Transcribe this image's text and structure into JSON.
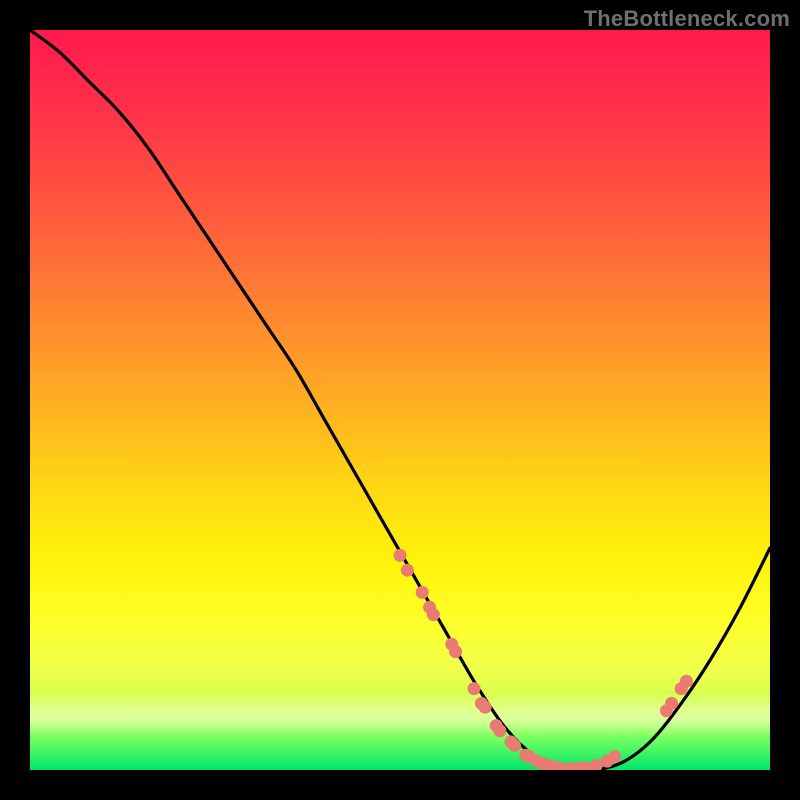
{
  "attribution": "TheBottleneck.com",
  "chart_data": {
    "type": "line",
    "title": "",
    "xlabel": "",
    "ylabel": "",
    "xlim": [
      0,
      100
    ],
    "ylim": [
      0,
      100
    ],
    "background_gradient": {
      "orientation": "vertical",
      "stops": [
        {
          "pos": 0.0,
          "color": "#ff1a4d"
        },
        {
          "pos": 0.25,
          "color": "#ff5a3d"
        },
        {
          "pos": 0.5,
          "color": "#ffb41f"
        },
        {
          "pos": 0.72,
          "color": "#fff40a"
        },
        {
          "pos": 0.92,
          "color": "#c8ff50"
        },
        {
          "pos": 1.0,
          "color": "#00e46a"
        }
      ]
    },
    "series": [
      {
        "name": "bottleneck-curve",
        "color": "#000000",
        "x": [
          0,
          4,
          8,
          12,
          16,
          20,
          24,
          28,
          32,
          36,
          40,
          44,
          48,
          52,
          56,
          60,
          64,
          68,
          72,
          76,
          80,
          84,
          88,
          92,
          96,
          100
        ],
        "values": [
          100,
          97,
          93,
          89,
          84,
          78,
          72,
          66,
          60,
          54,
          47,
          40,
          33,
          26,
          19,
          12,
          6,
          2,
          0,
          0,
          1,
          4,
          9,
          15,
          22,
          30
        ]
      }
    ],
    "scatter": [
      {
        "name": "highlight-points",
        "color": "#e97b73",
        "points": [
          {
            "x": 50,
            "y": 29
          },
          {
            "x": 51,
            "y": 27
          },
          {
            "x": 53,
            "y": 24
          },
          {
            "x": 54,
            "y": 22
          },
          {
            "x": 54.5,
            "y": 21
          },
          {
            "x": 57,
            "y": 17
          },
          {
            "x": 57.5,
            "y": 16
          },
          {
            "x": 60,
            "y": 11
          },
          {
            "x": 61,
            "y": 9
          },
          {
            "x": 61.5,
            "y": 8.5
          },
          {
            "x": 63,
            "y": 6
          },
          {
            "x": 63.5,
            "y": 5.3
          },
          {
            "x": 65,
            "y": 3.8
          },
          {
            "x": 65.5,
            "y": 3.3
          },
          {
            "x": 67,
            "y": 2
          },
          {
            "x": 67.5,
            "y": 1.8
          },
          {
            "x": 68.5,
            "y": 1.2
          },
          {
            "x": 69.5,
            "y": 0.8
          },
          {
            "x": 70.5,
            "y": 0.5
          },
          {
            "x": 71.5,
            "y": 0.3
          },
          {
            "x": 73,
            "y": 0.2
          },
          {
            "x": 74,
            "y": 0.2
          },
          {
            "x": 75,
            "y": 0.3
          },
          {
            "x": 76.5,
            "y": 0.6
          },
          {
            "x": 78,
            "y": 1.2
          },
          {
            "x": 79,
            "y": 1.8
          },
          {
            "x": 86,
            "y": 8
          },
          {
            "x": 86.7,
            "y": 9
          },
          {
            "x": 88,
            "y": 11
          },
          {
            "x": 88.7,
            "y": 12
          }
        ]
      }
    ]
  }
}
